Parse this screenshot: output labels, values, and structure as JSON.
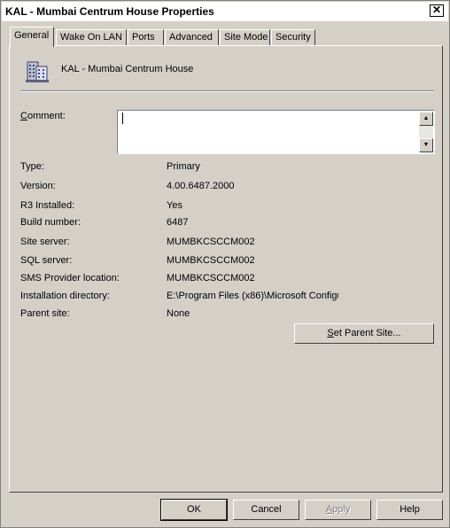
{
  "window": {
    "title": "KAL - Mumbai Centrum House Properties",
    "close_symbol": "✕"
  },
  "tabs": [
    {
      "label": "General",
      "active": true
    },
    {
      "label": "Wake On LAN",
      "active": false
    },
    {
      "label": "Ports",
      "active": false
    },
    {
      "label": "Advanced",
      "active": false
    },
    {
      "label": "Site Mode",
      "active": false
    },
    {
      "label": "Security",
      "active": false
    }
  ],
  "general": {
    "site_icon": "site-server-icon",
    "site_name": "KAL - Mumbai Centrum House",
    "comment_label": "Comment:",
    "comment_value": "",
    "properties": [
      {
        "label": "Type:",
        "value": "Primary"
      },
      {
        "label": "Version:",
        "value": "4.00.6487.2000"
      },
      {
        "label": "R3 Installed:",
        "value": "Yes"
      },
      {
        "label": "Build number:",
        "value": "6487"
      },
      {
        "label": "Site server:",
        "value": "MUMBKCSCCM002"
      },
      {
        "label": "SQL server:",
        "value": "MUMBKCSCCM002"
      },
      {
        "label": "SMS Provider location:",
        "value": "MUMBKCSCCM002"
      },
      {
        "label": "Installation directory:",
        "value": "E:\\Program Files (x86)\\Microsoft Configu"
      },
      {
        "label": "Parent site:",
        "value": "None"
      }
    ],
    "set_parent_button": "Set Parent Site..."
  },
  "footer": {
    "ok": "OK",
    "cancel": "Cancel",
    "apply": "Apply",
    "help": "Help"
  },
  "colors": {
    "dialog_bg": "#d4d0c8",
    "disabled_text": "#808080"
  }
}
